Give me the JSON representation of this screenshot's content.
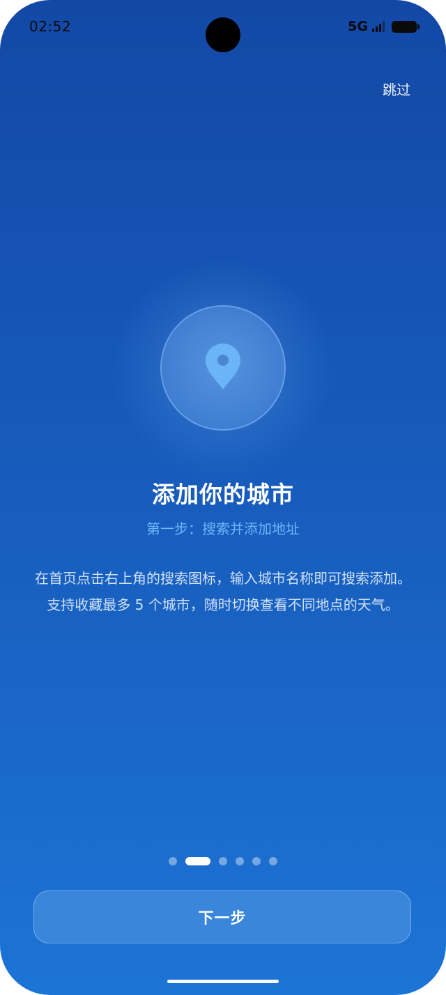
{
  "status_bar": {
    "time": "02:52",
    "network": "5G"
  },
  "header": {
    "skip_label": "跳过"
  },
  "onboarding": {
    "icon": "location-pin-icon",
    "title": "添加你的城市",
    "subtitle": "第一步：搜索并添加地址",
    "description": "在首页点击右上角的搜索图标，输入城市名称即可搜索添加。支持收藏最多 5 个城市，随时切换查看不同地点的天气。",
    "page_count": 6,
    "current_page": 2
  },
  "footer": {
    "next_label": "下一步"
  },
  "colors": {
    "background_top": "#1348a6",
    "background_bottom": "#1c74d6",
    "subtitle": "#6fb4f6",
    "pin": "#6ab5f8"
  }
}
